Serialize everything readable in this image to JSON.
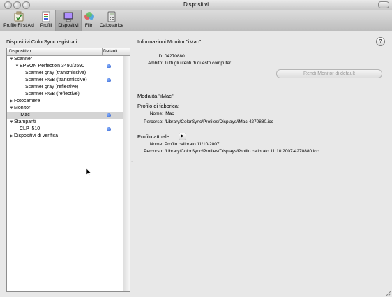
{
  "window": {
    "title": "Dispositivi"
  },
  "toolbar": {
    "items": [
      {
        "label": "Profile First Aid",
        "icon": "first-aid-icon"
      },
      {
        "label": "Profili",
        "icon": "profiles-icon"
      },
      {
        "label": "Dispositivi",
        "icon": "devices-icon",
        "selected": true
      },
      {
        "label": "Filtri",
        "icon": "filters-icon"
      },
      {
        "label": "Calcolatrice",
        "icon": "calculator-icon"
      }
    ]
  },
  "left": {
    "title": "Dispositivi ColorSync registrati:",
    "col_device": "Dispositivo",
    "col_default": "Default",
    "rows": [
      {
        "label": "Scanner",
        "tri": "▼",
        "indent": 0,
        "default": false
      },
      {
        "label": "EPSON Perfection 3490/3590",
        "tri": "▼",
        "indent": 1,
        "default": true
      },
      {
        "label": "Scanner gray (transmissive)",
        "tri": "",
        "indent": 2,
        "default": false
      },
      {
        "label": "Scanner RGB (transmissive)",
        "tri": "",
        "indent": 2,
        "default": true
      },
      {
        "label": "Scanner gray (reflective)",
        "tri": "",
        "indent": 2,
        "default": false
      },
      {
        "label": "Scanner RGB (reflective)",
        "tri": "",
        "indent": 2,
        "default": false
      },
      {
        "label": "Fotocamere",
        "tri": "▶",
        "indent": 0,
        "default": false
      },
      {
        "label": "Monitor",
        "tri": "▼",
        "indent": 0,
        "default": false
      },
      {
        "label": "iMac",
        "tri": "",
        "indent": 1,
        "default": true,
        "selected": true
      },
      {
        "label": "Stampanti",
        "tri": "▼",
        "indent": 0,
        "default": false
      },
      {
        "label": "CLP_510",
        "tri": "",
        "indent": 1,
        "default": true
      },
      {
        "label": "Dispositivi di verifica",
        "tri": "▶",
        "indent": 0,
        "default": false
      }
    ]
  },
  "info": {
    "title": "Informazioni Monitor \"iMac\"",
    "id_label": "ID:",
    "id_value": "04270880",
    "scope_label": "Ambito:",
    "scope_value": "Tutti gli utenti di questo computer",
    "default_button": "Rendi Monitor di default",
    "help": "?"
  },
  "mode": {
    "title": "Modalità \"iMac\"",
    "factory": {
      "heading": "Profilo di fabbrica:",
      "name_label": "Nome:",
      "name_value": "iMac",
      "path_label": "Percorso:",
      "path_value": "/Library/ColorSync/Profiles/Displays/iMac-4270880.icc"
    },
    "current": {
      "heading": "Profilo attuale:",
      "name_label": "Nome:",
      "name_value": "Profilo calibrato 11/10/2007",
      "path_label": "Percorso:",
      "path_value": "/Library/ColorSync/Profiles/Displays/Profilo calibrato 11:10:2007-4270880.icc"
    }
  }
}
